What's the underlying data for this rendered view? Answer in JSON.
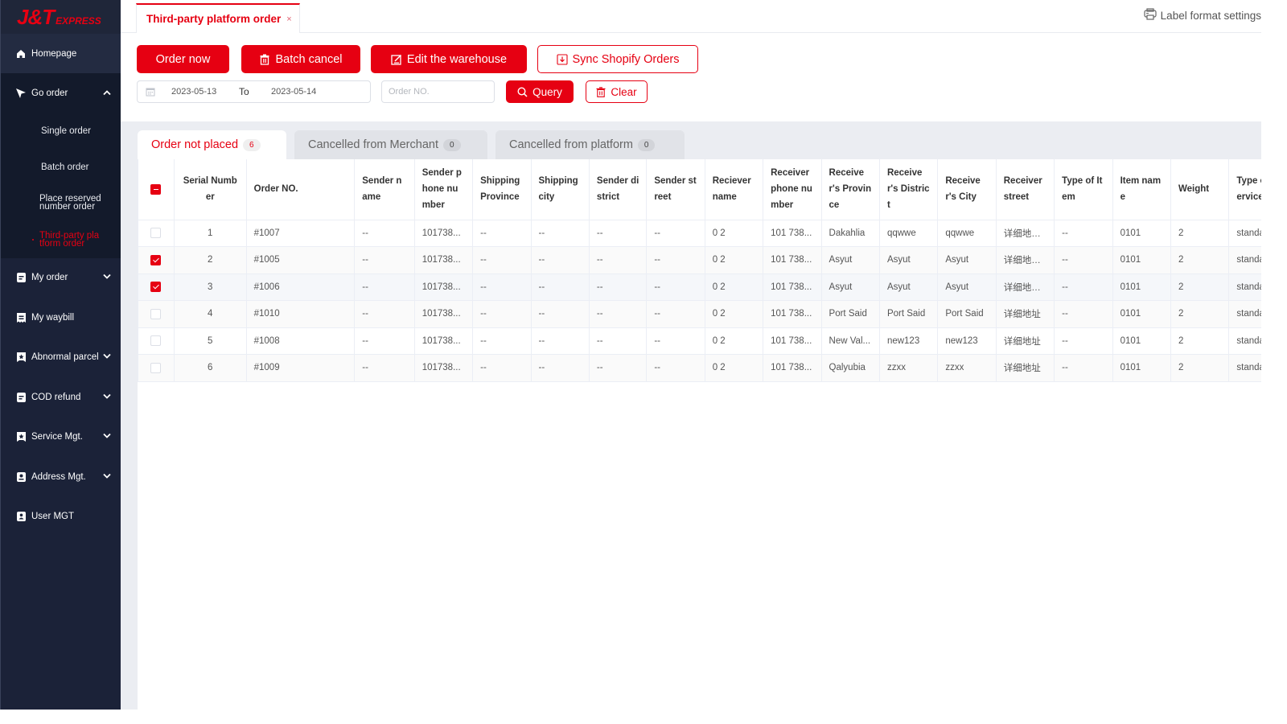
{
  "brand": {
    "logo_main": "J&T",
    "logo_sub": "EXPRESS",
    "accent_color": "#e60012",
    "sidebar_color": "#1b2238"
  },
  "sidebar": {
    "items": [
      {
        "label": "Homepage",
        "icon": "home-icon"
      },
      {
        "label": "Go order",
        "icon": "cursor-icon",
        "expanded": true,
        "children": [
          {
            "label": "Single order"
          },
          {
            "label": "Batch order"
          },
          {
            "label": "Place reserved number order"
          },
          {
            "label": "Third-party platform order",
            "active": true
          }
        ]
      },
      {
        "label": "My order",
        "icon": "document-icon"
      },
      {
        "label": "My waybill",
        "icon": "receipt-icon"
      },
      {
        "label": "Abnormal parcel",
        "icon": "parcel-alert-icon"
      },
      {
        "label": "COD refund",
        "icon": "document-icon"
      },
      {
        "label": "Service Mgt.",
        "icon": "service-icon"
      },
      {
        "label": "Address Mgt.",
        "icon": "address-icon"
      },
      {
        "label": "User MGT",
        "icon": "user-icon"
      }
    ]
  },
  "topbar": {
    "page_tab": "Third-party platform order",
    "close_symbol": "×",
    "label_settings": "Label format settings"
  },
  "toolbar": {
    "order_now": "Order now",
    "batch_cancel": "Batch cancel",
    "edit_warehouse": "Edit the warehouse",
    "sync_shopify": "Sync Shopify Orders",
    "date_start": "2023-05-13",
    "date_to": "To",
    "date_end": "2023-05-14",
    "order_placeholder": "Order NO.",
    "order_value": "",
    "query": "Query",
    "clear": "Clear"
  },
  "tabs": [
    {
      "label": "Order not placed",
      "count": "6",
      "active": true
    },
    {
      "label": "Cancelled from Merchant",
      "count": "0"
    },
    {
      "label": "Cancelled from platform",
      "count": "0"
    }
  ],
  "table": {
    "header_select_state": "indeterminate",
    "columns": [
      "Serial Number",
      "Order NO.",
      "Sender name",
      "Sender phone number",
      "Shipping Province",
      "Shipping city",
      "Sender district",
      "Sender street",
      "Reciever name",
      "Receiver phone number",
      "Receiver's Province",
      "Receiver's District",
      "Receiver's City",
      "Receiver street",
      "Type of Item",
      "Item name",
      "Weight",
      "Type of Service"
    ],
    "rows": [
      {
        "checked": false,
        "cells": [
          "1",
          "#1007",
          "--",
          "101738...",
          "--",
          "--",
          "--",
          "--",
          "0 2",
          "101 738...",
          "Dakahlia",
          "qqwwe",
          "qqwwe",
          "详细地址...",
          "--",
          "0101",
          "2",
          "standard"
        ]
      },
      {
        "checked": true,
        "cells": [
          "2",
          "#1005",
          "--",
          "101738...",
          "--",
          "--",
          "--",
          "--",
          "0 2",
          "101 738...",
          "Asyut",
          "Asyut",
          "Asyut",
          "详细地址...",
          "--",
          "0101",
          "2",
          "standard"
        ]
      },
      {
        "checked": true,
        "cells": [
          "3",
          "#1006",
          "--",
          "101738...",
          "--",
          "--",
          "--",
          "--",
          "0 2",
          "101 738...",
          "Asyut",
          "Asyut",
          "Asyut",
          "详细地址...",
          "--",
          "0101",
          "2",
          "standard"
        ]
      },
      {
        "checked": false,
        "cells": [
          "4",
          "#1010",
          "--",
          "101738...",
          "--",
          "--",
          "--",
          "--",
          "0 2",
          "101 738...",
          "Port Said",
          "Port Said",
          "Port Said",
          "详细地址",
          "--",
          "0101",
          "2",
          "standard"
        ]
      },
      {
        "checked": false,
        "cells": [
          "5",
          "#1008",
          "--",
          "101738...",
          "--",
          "--",
          "--",
          "--",
          "0 2",
          "101 738...",
          "New Val...",
          "new123",
          "new123",
          "详细地址",
          "--",
          "0101",
          "2",
          "standard"
        ]
      },
      {
        "checked": false,
        "cells": [
          "6",
          "#1009",
          "--",
          "101738...",
          "--",
          "--",
          "--",
          "--",
          "0 2",
          "101 738...",
          "Qalyubia",
          "zzxx",
          "zzxx",
          "详细地址",
          "--",
          "0101",
          "2",
          "standard"
        ]
      }
    ]
  }
}
